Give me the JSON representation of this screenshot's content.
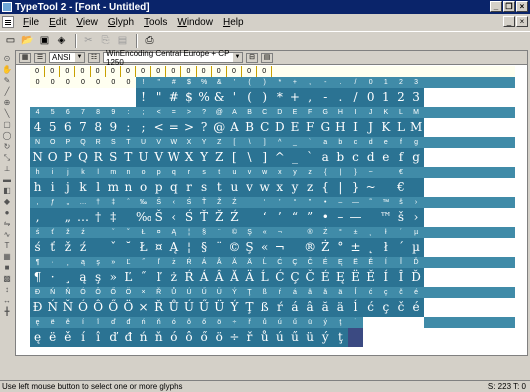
{
  "titlebar": {
    "title": "TypeTool 2 - [Font - Untitled]",
    "minimize": "_",
    "restore": "❐",
    "close": "×"
  },
  "menubar": {
    "items": [
      "File",
      "Edit",
      "View",
      "Glyph",
      "Tools",
      "Window",
      "Help"
    ]
  },
  "toolbar": {
    "icons": [
      "new-icon",
      "open-icon",
      "save-icon",
      "font-icon",
      "cut-icon",
      "copy-icon",
      "paste-icon",
      "print-icon"
    ]
  },
  "doc_toolbar": {
    "codepage_label": "ANSI",
    "encoding_label": "WinEncoding Central Europe + CP 1250"
  },
  "rows": [
    {
      "kind": "small-top",
      "cells": [
        "0",
        "0",
        "0",
        "0",
        "0",
        "0",
        "0",
        "0",
        "0",
        "0",
        "0",
        "0",
        "0",
        "0",
        "0",
        "0"
      ]
    },
    {
      "kind": "small",
      "cells": [
        "0",
        "0",
        "0",
        "0",
        "0",
        "0",
        "0",
        "!",
        "\"",
        "#",
        "$",
        "%",
        "&",
        "'",
        "(",
        ")",
        "*",
        "+",
        ",",
        "-",
        ".",
        "/",
        "0",
        "1",
        "2",
        "3"
      ]
    },
    {
      "kind": "big",
      "cells": [
        "",
        "",
        "",
        "",
        "",
        "",
        "",
        "!",
        "\"",
        "#",
        "$",
        "%",
        "&",
        "'",
        "(",
        ")",
        "*",
        "+",
        ",",
        "-",
        ".",
        "/",
        "0",
        "1",
        "2",
        "3"
      ]
    },
    {
      "kind": "small",
      "cells": [
        "4",
        "5",
        "6",
        "7",
        "8",
        "9",
        ":",
        ";",
        "<",
        "=",
        ">",
        "?",
        "@",
        "A",
        "B",
        "C",
        "D",
        "E",
        "F",
        "G",
        "H",
        "I",
        "J",
        "K",
        "L",
        "M"
      ]
    },
    {
      "kind": "big",
      "cells": [
        "4",
        "5",
        "6",
        "7",
        "8",
        "9",
        ":",
        ";",
        "<",
        "=",
        ">",
        "?",
        "@",
        "A",
        "B",
        "C",
        "D",
        "E",
        "F",
        "G",
        "H",
        "I",
        "J",
        "K",
        "L",
        "M"
      ]
    },
    {
      "kind": "small",
      "cells": [
        "N",
        "O",
        "P",
        "Q",
        "R",
        "S",
        "T",
        "U",
        "V",
        "W",
        "X",
        "Y",
        "Z",
        "[",
        "\\",
        "]",
        "^",
        "_",
        "`",
        "a",
        "b",
        "c",
        "d",
        "e",
        "f",
        "g"
      ]
    },
    {
      "kind": "big",
      "cells": [
        "N",
        "O",
        "P",
        "Q",
        "R",
        "S",
        "T",
        "U",
        "V",
        "W",
        "X",
        "Y",
        "Z",
        "[",
        "\\",
        "]",
        "^",
        "_",
        "`",
        "a",
        "b",
        "c",
        "d",
        "e",
        "f",
        "g"
      ]
    },
    {
      "kind": "small",
      "cells": [
        "h",
        "i",
        "j",
        "k",
        "l",
        "m",
        "n",
        "o",
        "p",
        "q",
        "r",
        "s",
        "t",
        "u",
        "v",
        "w",
        "x",
        "y",
        "z",
        "{",
        "|",
        "}",
        "~",
        "",
        "€",
        ""
      ]
    },
    {
      "kind": "big",
      "cells": [
        "h",
        "i",
        "j",
        "k",
        "l",
        "m",
        "n",
        "o",
        "p",
        "q",
        "r",
        "s",
        "t",
        "u",
        "v",
        "w",
        "x",
        "y",
        "z",
        "{",
        "|",
        "}",
        "~",
        "",
        "€",
        ""
      ]
    },
    {
      "kind": "small",
      "cells": [
        "‚",
        "ƒ",
        "„",
        "…",
        "†",
        "‡",
        "ˆ",
        "‰",
        "Š",
        "‹",
        "Ś",
        "Ť",
        "Ž",
        "Ź",
        "",
        "‘",
        "’",
        "“",
        "”",
        "•",
        "–",
        "—",
        "˜",
        "™",
        "š",
        "›"
      ]
    },
    {
      "kind": "big",
      "cells": [
        "‚",
        "",
        "„",
        "…",
        "†",
        "‡",
        "",
        "‰",
        "Š",
        "‹",
        "Ś",
        "Ť",
        "Ž",
        "Ź",
        "",
        "‘",
        "’",
        "“",
        "”",
        "•",
        "–",
        "—",
        "",
        "™",
        "š",
        "›"
      ]
    },
    {
      "kind": "small",
      "cells": [
        "ś",
        "ť",
        "ž",
        "ź",
        "",
        "ˇ",
        "˘",
        "Ł",
        "¤",
        "Ą",
        "¦",
        "§",
        "¨",
        "©",
        "Ş",
        "«",
        "¬",
        "­",
        "®",
        "Ż",
        "°",
        "±",
        "˛",
        "ł",
        "´",
        "µ"
      ]
    },
    {
      "kind": "big",
      "cells": [
        "ś",
        "ť",
        "ž",
        "ź",
        "",
        "ˇ",
        "˘",
        "Ł",
        "¤",
        "Ą",
        "¦",
        "§",
        "¨",
        "©",
        "Ş",
        "«",
        "¬",
        "",
        "®",
        "Ż",
        "°",
        "±",
        "˛",
        "ł",
        "´",
        "µ"
      ]
    },
    {
      "kind": "small",
      "cells": [
        "¶",
        "·",
        "¸",
        "ą",
        "ş",
        "»",
        "Ľ",
        "˝",
        "ľ",
        "ż",
        "Ŕ",
        "Á",
        "Â",
        "Ă",
        "Ä",
        "Ĺ",
        "Ć",
        "Ç",
        "Č",
        "É",
        "Ę",
        "Ë",
        "Ě",
        "Í",
        "Î",
        "Ď"
      ]
    },
    {
      "kind": "big",
      "cells": [
        "¶",
        "·",
        "¸",
        "ą",
        "ş",
        "»",
        "Ľ",
        "˝",
        "ľ",
        "ż",
        "Ŕ",
        "Á",
        "Â",
        "Ă",
        "Ä",
        "Ĺ",
        "Ć",
        "Ç",
        "Č",
        "É",
        "Ę",
        "Ë",
        "Ě",
        "Í",
        "Î",
        "Ď"
      ]
    },
    {
      "kind": "small",
      "cells": [
        "Đ",
        "Ń",
        "Ň",
        "Ó",
        "Ô",
        "Ő",
        "Ö",
        "×",
        "Ř",
        "Ů",
        "Ú",
        "Ű",
        "Ü",
        "Ý",
        "Ţ",
        "ß",
        "ŕ",
        "á",
        "â",
        "ă",
        "ä",
        "ĺ",
        "ć",
        "ç",
        "č",
        "é"
      ]
    },
    {
      "kind": "big",
      "cells": [
        "Đ",
        "Ń",
        "Ň",
        "Ó",
        "Ô",
        "Ő",
        "Ö",
        "×",
        "Ř",
        "Ů",
        "Ú",
        "Ű",
        "Ü",
        "Ý",
        "Ţ",
        "ß",
        "ŕ",
        "á",
        "â",
        "ă",
        "ä",
        "ĺ",
        "ć",
        "ç",
        "č",
        "é"
      ]
    },
    {
      "kind": "small",
      "cells": [
        "ę",
        "ë",
        "ě",
        "í",
        "î",
        "ď",
        "đ",
        "ń",
        "ň",
        "ó",
        "ô",
        "ő",
        "ö",
        "÷",
        "ř",
        "ů",
        "ú",
        "ű",
        "ü",
        "ý",
        "ţ",
        "˙",
        "",
        "",
        "",
        ""
      ]
    },
    {
      "kind": "big",
      "cells": [
        "ę",
        "ë",
        "ě",
        "í",
        "î",
        "ď",
        "đ",
        "ń",
        "ň",
        "ó",
        "ô",
        "ő",
        "ö",
        "÷",
        "ř",
        "ů",
        "ú",
        "ű",
        "ü",
        "ý",
        "ţ",
        "",
        "",
        "",
        "",
        ""
      ]
    }
  ],
  "statusbar": {
    "message": "Use left mouse button to select one or more glyphs",
    "position": "S: 223 T: 0"
  },
  "colors": {
    "cell_blue": "#2b7393",
    "label_blue": "#408ba8",
    "selected": "#3b4a82",
    "title_bar": "#0a246a"
  }
}
